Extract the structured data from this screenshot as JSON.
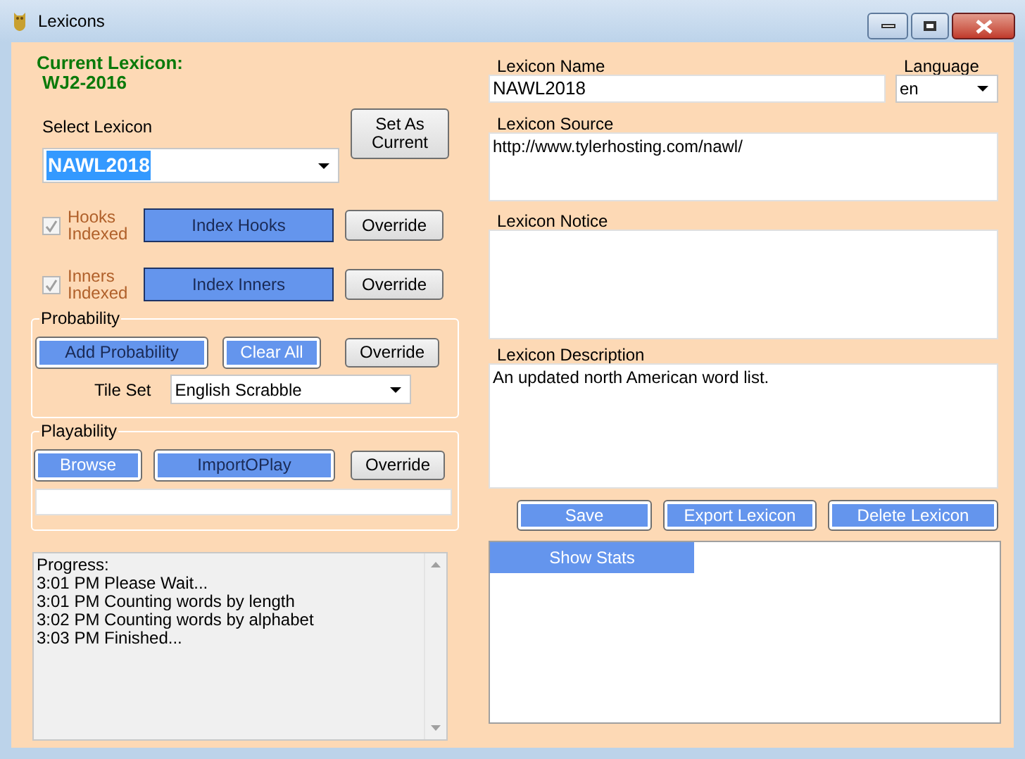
{
  "window": {
    "title": "Lexicons"
  },
  "current_lexicon": {
    "label": "Current Lexicon:",
    "value": "WJ2-2016"
  },
  "select_lexicon": {
    "label": "Select Lexicon",
    "value": "NAWL2018",
    "set_button": {
      "label": "Set As Current",
      "kind": "system"
    }
  },
  "index_rows": [
    {
      "checkbox": {
        "label": "Hooks Indexed",
        "checked": true,
        "disabled": true
      },
      "button": {
        "label": "Index Hooks",
        "kind": "accent"
      },
      "override": {
        "label": "Override",
        "kind": "system"
      }
    },
    {
      "checkbox": {
        "label": "Inners Indexed",
        "checked": true,
        "disabled": true
      },
      "button": {
        "label": "Index Inners",
        "kind": "accent"
      },
      "override": {
        "label": "Override",
        "kind": "system"
      }
    }
  ],
  "probability": {
    "title": "Probability",
    "buttons": [
      {
        "label": "Add Probability",
        "kind": "accent_framed"
      },
      {
        "label": "Clear All",
        "kind": "accent_framed_light"
      },
      {
        "label": "Override",
        "kind": "system"
      }
    ],
    "tile_set": {
      "label": "Tile Set",
      "value": "English Scrabble"
    }
  },
  "playability": {
    "title": "Playability",
    "buttons": [
      {
        "label": "Browse",
        "kind": "accent_framed_light"
      },
      {
        "label": "ImportOPlay",
        "kind": "accent_framed"
      },
      {
        "label": "Override",
        "kind": "system"
      }
    ]
  },
  "progress_log": [
    "Progress:",
    "3:01 PM Please Wait...",
    "3:01 PM Counting words by length",
    "3:02 PM Counting words by alphabet",
    "3:03 PM Finished..."
  ],
  "lexicon_name": {
    "label": "Lexicon Name",
    "value": "NAWL2018"
  },
  "language": {
    "label": "Language",
    "value": "en"
  },
  "lexicon_source": {
    "label": "Lexicon Source",
    "value": "http://www.tylerhosting.com/nawl/"
  },
  "lexicon_notice": {
    "label": "Lexicon Notice"
  },
  "lexicon_description": {
    "label": "Lexicon Description",
    "value": "An updated north American word list."
  },
  "actions": [
    {
      "label": "Save",
      "kind": "accent_framed_light"
    },
    {
      "label": "Export Lexicon",
      "kind": "accent_framed_light"
    },
    {
      "label": "Delete Lexicon",
      "kind": "accent_framed_light"
    }
  ],
  "stats": {
    "button": {
      "label": "Show Stats",
      "kind": "accent_light"
    }
  }
}
